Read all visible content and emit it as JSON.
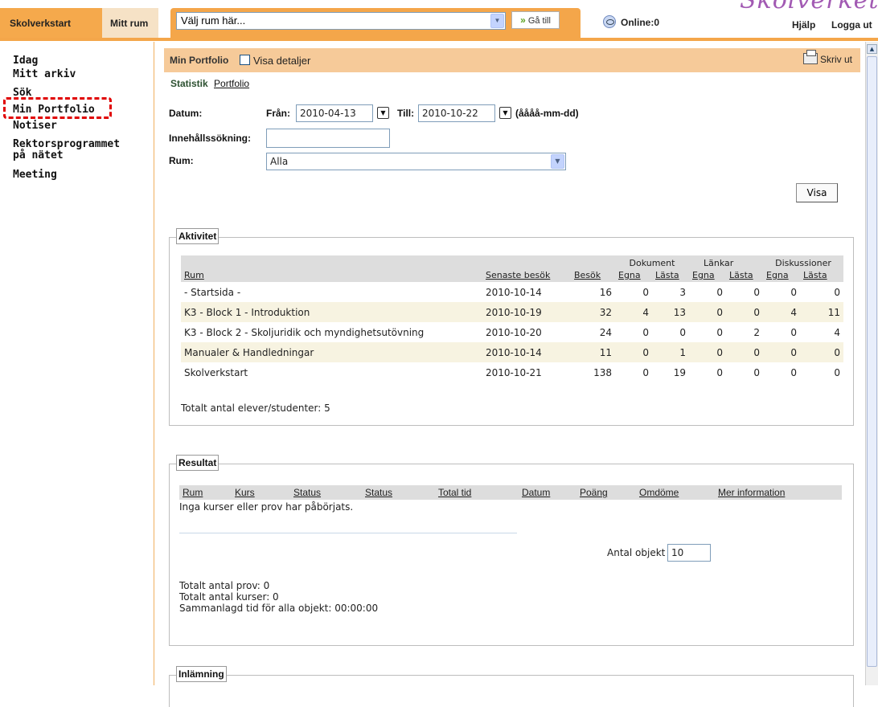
{
  "topbar": {
    "tabs": [
      {
        "label": "Skolverkstart"
      },
      {
        "label": "Mitt rum"
      }
    ],
    "room_select": {
      "value": "Välj rum här..."
    },
    "goto_label": "Gå till",
    "online_label": "Online:0",
    "logo_text": "Skolverket",
    "help_label": "Hjälp",
    "logout_label": "Logga ut",
    "accent_color": "#f4a64a"
  },
  "nav": {
    "items": [
      {
        "label": "Idag"
      },
      {
        "label": "Mitt arkiv"
      },
      {
        "label": "Sök"
      },
      {
        "label": "Min Portfolio"
      },
      {
        "label": "Notiser"
      },
      {
        "label": "Rektorsprogrammet"
      },
      {
        "label": "på nätet"
      },
      {
        "label": "Meeting"
      }
    ],
    "highlighted": "Min Portfolio"
  },
  "portfolio": {
    "title": "Min Portfolio",
    "details_label": "Visa detaljer",
    "details_checked": false,
    "print_label": "Skriv ut",
    "subtab_active": "Statistik",
    "subtab_link": "Portfolio"
  },
  "filter": {
    "datum_label": "Datum:",
    "from_label": "Från:",
    "from_value": "2010-04-13",
    "to_label": "Till:",
    "to_value": "2010-10-22",
    "date_format": "(åååå-mm-dd)",
    "content_search_label": "Innehållssökning:",
    "content_search_value": "",
    "room_label": "Rum:",
    "room_value": "Alla",
    "show_button": "Visa"
  },
  "aktivitet": {
    "legend": "Aktivitet",
    "group_headers": {
      "dokument": "Dokument",
      "lankar": "Länkar",
      "diskussioner": "Diskussioner"
    },
    "columns": {
      "rum": "Rum",
      "senaste": "Senaste besök",
      "besok": "Besök",
      "d_egna": "Egna",
      "d_lasta": "Lästa",
      "l_egna": "Egna",
      "l_lasta": "Lästa",
      "k_egna": "Egna",
      "k_lasta": "Lästa"
    },
    "rows": [
      {
        "rum": "- Startsida -",
        "senaste": "2010-10-14",
        "besok": "16",
        "d_egna": "0",
        "d_lasta": "3",
        "l_egna": "0",
        "l_lasta": "0",
        "k_egna": "0",
        "k_lasta": "0"
      },
      {
        "rum": "K3 - Block 1 - Introduktion",
        "senaste": "2010-10-19",
        "besok": "32",
        "d_egna": "4",
        "d_lasta": "13",
        "l_egna": "0",
        "l_lasta": "0",
        "k_egna": "4",
        "k_lasta": "11"
      },
      {
        "rum": "K3 - Block 2 - Skoljuridik och myndighetsutövning",
        "senaste": "2010-10-20",
        "besok": "24",
        "d_egna": "0",
        "d_lasta": "0",
        "l_egna": "0",
        "l_lasta": "2",
        "k_egna": "0",
        "k_lasta": "4"
      },
      {
        "rum": "Manualer & Handledningar",
        "senaste": "2010-10-14",
        "besok": "11",
        "d_egna": "0",
        "d_lasta": "1",
        "l_egna": "0",
        "l_lasta": "0",
        "k_egna": "0",
        "k_lasta": "0"
      },
      {
        "rum": "Skolverkstart",
        "senaste": "2010-10-21",
        "besok": "138",
        "d_egna": "0",
        "d_lasta": "19",
        "l_egna": "0",
        "l_lasta": "0",
        "k_egna": "0",
        "k_lasta": "0"
      }
    ],
    "total_students": "Totalt antal elever/studenter: 5"
  },
  "resultat": {
    "legend": "Resultat",
    "columns": [
      "Rum",
      "Kurs",
      "Status",
      "Status",
      "Total tid",
      "Datum",
      "Poäng",
      "Omdöme",
      "Mer information"
    ],
    "empty_text": "Inga kurser eller prov har påbörjats.",
    "count_label": "Antal objekt",
    "count_value": "10",
    "summary": [
      "Totalt antal prov: 0",
      "Totalt antal kurser: 0",
      "Sammanlagd tid för alla objekt: 00:00:00"
    ]
  },
  "inlamning": {
    "legend": "Inlämning"
  }
}
